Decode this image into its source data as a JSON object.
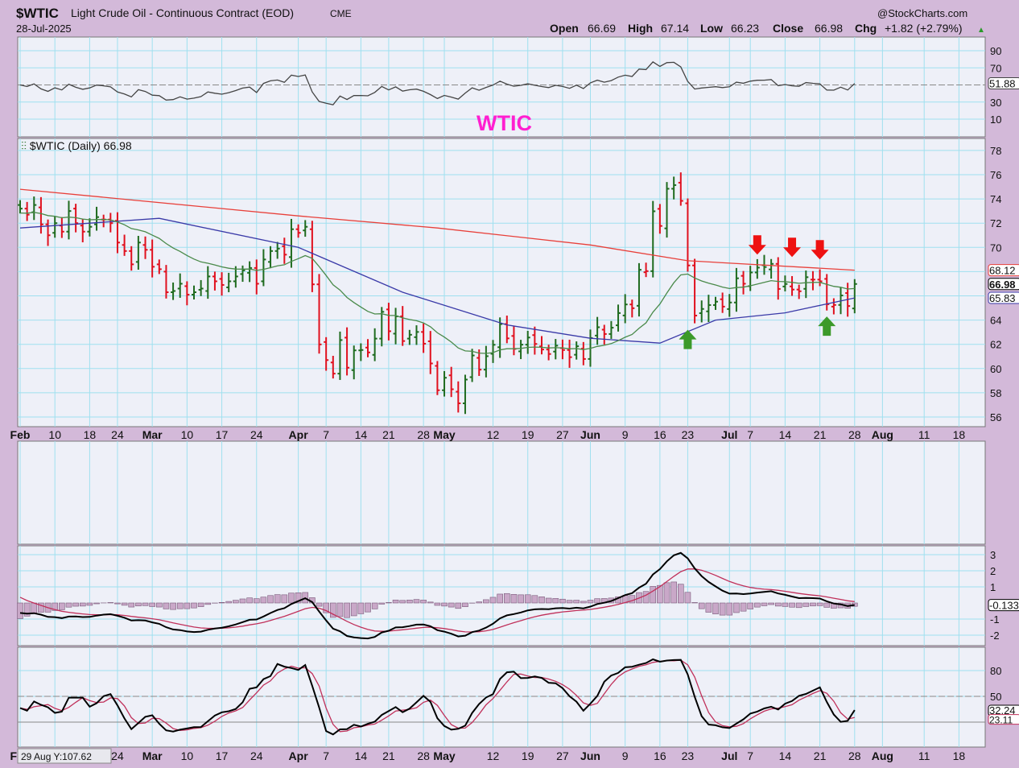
{
  "header": {
    "symbol": "$WTIC",
    "name": "Light Crude Oil - Continuous Contract (EOD)",
    "exchange": "CME",
    "date": "28-Jul-2025",
    "brand": "@StockCharts.com",
    "open_label": "Open",
    "open": "66.69",
    "high_label": "High",
    "high": "67.14",
    "low_label": "Low",
    "low": "66.23",
    "close_label": "Close",
    "close": "66.98",
    "chg_label": "Chg",
    "chg": "+1.82 (+2.79%)"
  },
  "annotation_title": "WTIC",
  "price_legend": "$WTIC (Daily) 66.98",
  "hover_readout": "29 Aug Y:107.62",
  "colors": {
    "up": "#1f6b1f",
    "down": "#e0101e",
    "ma200": "#e8403a",
    "ma50": "#3a3aa8",
    "ema20": "#4a8a4a",
    "title": "#ff1fd0",
    "arrow_red": "#ee1111",
    "arrow_green": "#3c9a2a"
  },
  "chart_data": {
    "type": "line",
    "title": "$WTIC Light Crude Oil - Continuous Contract (EOD)",
    "start_date": "2025-02-03",
    "closes": [
      73.2,
      72.7,
      73.5,
      71.9,
      71.0,
      72.0,
      71.3,
      73.0,
      72.0,
      71.3,
      71.7,
      72.5,
      72.3,
      72.0,
      70.4,
      69.7,
      68.6,
      70.4,
      69.8,
      68.4,
      68.2,
      66.3,
      66.4,
      67.0,
      66.1,
      66.3,
      66.6,
      67.6,
      67.2,
      66.9,
      67.2,
      67.6,
      68.1,
      68.3,
      67.0,
      69.0,
      69.7,
      69.9,
      69.4,
      71.5,
      71.2,
      71.7,
      66.95,
      61.99,
      60.7,
      59.58,
      62.35,
      60.07,
      61.5,
      61.53,
      61.33,
      62.47,
      64.68,
      63.08,
      64.31,
      62.27,
      62.79,
      63.02,
      62.05,
      60.42,
      58.21,
      59.24,
      58.29,
      57.13,
      59.09,
      61.08,
      59.91,
      61.02,
      61.96,
      63.67,
      62.49,
      61.62,
      61.97,
      62.56,
      62.03,
      61.57,
      61.2,
      61.89,
      61.53,
      60.94,
      61.84,
      60.79,
      62.52,
      63.41,
      62.85,
      63.37,
      64.58,
      65.29,
      64.98,
      68.15,
      68.04,
      72.98,
      71.77,
      74.84,
      75.14,
      73.84,
      68.51,
      64.37,
      64.92,
      65.24,
      65.52,
      65.11,
      65.45,
      67.45,
      67.0,
      67.93,
      68.33,
      68.38,
      68.64,
      66.57,
      66.98,
      66.52,
      66.38,
      67.54,
      67.34,
      67.2,
      65.31,
      65.25,
      66.03,
      65.16,
      66.98
    ],
    "ma200_points": [
      [
        0,
        74.8
      ],
      [
        40,
        72.6
      ],
      [
        60,
        71.6
      ],
      [
        82,
        70.2
      ],
      [
        96,
        68.9
      ],
      [
        120,
        68.12
      ]
    ],
    "ma50_points": [
      [
        0,
        71.6
      ],
      [
        20,
        72.4
      ],
      [
        40,
        70.0
      ],
      [
        55,
        66.3
      ],
      [
        70,
        63.6
      ],
      [
        82,
        62.5
      ],
      [
        92,
        62.1
      ],
      [
        100,
        64.0
      ],
      [
        110,
        64.6
      ],
      [
        120,
        65.83
      ]
    ],
    "price_ylim": [
      56,
      78
    ],
    "price_ticks": [
      56,
      58,
      60,
      62,
      64,
      66,
      68,
      70,
      72,
      74,
      76,
      78
    ],
    "last_labels": {
      "ma200": "68.12",
      "close": "66.98",
      "ma50": "65.83"
    },
    "rsi": {
      "ticks": [
        10,
        30,
        70,
        90
      ],
      "last": "51.88",
      "ylim": [
        0,
        100
      ]
    },
    "macd": {
      "ticks": [
        3,
        2,
        1,
        -1,
        -2
      ],
      "last": "-0.133",
      "ylim": [
        -2.5,
        3.5
      ]
    },
    "stoch": {
      "ticks": [
        80,
        50
      ],
      "last_k": "32.24",
      "last_d": "23.11",
      "ylim": [
        0,
        100
      ]
    },
    "x_labels": [
      {
        "text": "Feb",
        "i": 0,
        "bold": true
      },
      {
        "text": "10",
        "i": 5
      },
      {
        "text": "18",
        "i": 10
      },
      {
        "text": "24",
        "i": 14
      },
      {
        "text": "Mar",
        "i": 19,
        "bold": true
      },
      {
        "text": "10",
        "i": 24
      },
      {
        "text": "17",
        "i": 29
      },
      {
        "text": "24",
        "i": 34
      },
      {
        "text": "Apr",
        "i": 40,
        "bold": true
      },
      {
        "text": "7",
        "i": 44
      },
      {
        "text": "14",
        "i": 49
      },
      {
        "text": "21",
        "i": 53
      },
      {
        "text": "28",
        "i": 58
      },
      {
        "text": "May",
        "i": 61,
        "bold": true
      },
      {
        "text": "12",
        "i": 68
      },
      {
        "text": "19",
        "i": 73
      },
      {
        "text": "27",
        "i": 78
      },
      {
        "text": "Jun",
        "i": 82,
        "bold": true
      },
      {
        "text": "9",
        "i": 87
      },
      {
        "text": "16",
        "i": 92
      },
      {
        "text": "23",
        "i": 96
      },
      {
        "text": "Jul",
        "i": 102,
        "bold": true
      },
      {
        "text": "7",
        "i": 105
      },
      {
        "text": "14",
        "i": 110
      },
      {
        "text": "21",
        "i": 115
      },
      {
        "text": "28",
        "i": 120
      },
      {
        "text": "Aug",
        "i": 124,
        "bold": true
      },
      {
        "text": "11",
        "i": 130
      },
      {
        "text": "18",
        "i": 135
      }
    ],
    "arrows": [
      {
        "type": "down",
        "i": 106,
        "price": 70.2
      },
      {
        "type": "down",
        "i": 111,
        "price": 70.0
      },
      {
        "type": "down",
        "i": 115,
        "price": 69.8
      },
      {
        "type": "up",
        "i": 96,
        "price": 62.4
      },
      {
        "type": "up",
        "i": 116,
        "price": 63.5
      }
    ]
  }
}
